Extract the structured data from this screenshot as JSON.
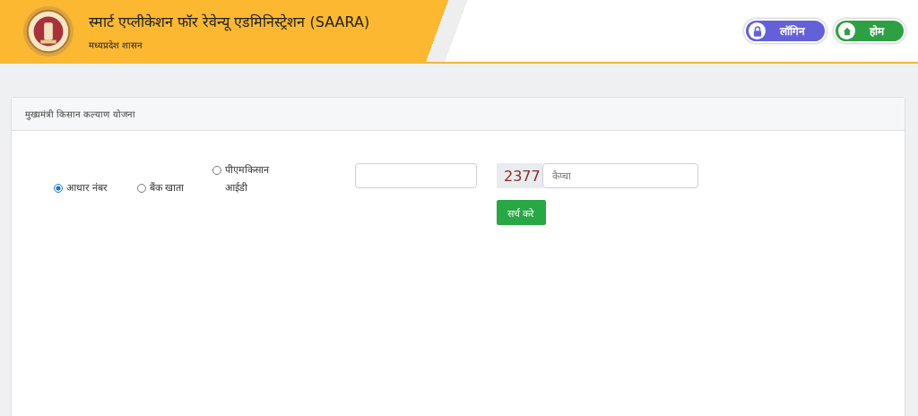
{
  "header": {
    "title": "स्मार्ट एप्लीकेशन फॉर रेवेन्यू एडमिनिस्ट्रेशन (SAARA)",
    "subtitle": "मध्यप्रदेश शासन"
  },
  "nav_buttons": [
    {
      "kind": "login",
      "label": "लॉगिन"
    },
    {
      "kind": "home",
      "label": "होम"
    }
  ],
  "card": {
    "title": "मुख्यमंत्री किसान कल्याण योजना",
    "options": [
      {
        "label": "आधार नंबर",
        "selected": true
      },
      {
        "label": "बैंक खाता",
        "selected": false
      },
      {
        "label": "पीएमकिसान आईडी",
        "selected": false
      }
    ],
    "captcha": {
      "code": "2377",
      "placeholder": "कैप्चा"
    },
    "search_button": "सर्च करे"
  }
}
